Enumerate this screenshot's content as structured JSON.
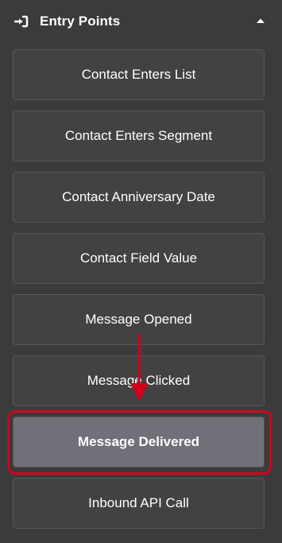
{
  "header": {
    "title": "Entry Points",
    "icon": "sign-in-icon",
    "collapse_icon": "caret-up-icon"
  },
  "entries": [
    {
      "label": "Contact Enters List",
      "highlighted": false
    },
    {
      "label": "Contact Enters Segment",
      "highlighted": false
    },
    {
      "label": "Contact Anniversary Date",
      "highlighted": false
    },
    {
      "label": "Contact Field Value",
      "highlighted": false
    },
    {
      "label": "Message Opened",
      "highlighted": false
    },
    {
      "label": "Message Clicked",
      "highlighted": false
    },
    {
      "label": "Message Delivered",
      "highlighted": true
    },
    {
      "label": "Inbound API Call",
      "highlighted": false
    }
  ],
  "annotation": {
    "color": "#d0021b",
    "target": "Message Delivered"
  },
  "colors": {
    "panel_bg": "#3b3b3b",
    "button_bg": "#424242",
    "button_border": "#575757",
    "button_highlight_bg": "#707078",
    "text": "#ffffff"
  }
}
